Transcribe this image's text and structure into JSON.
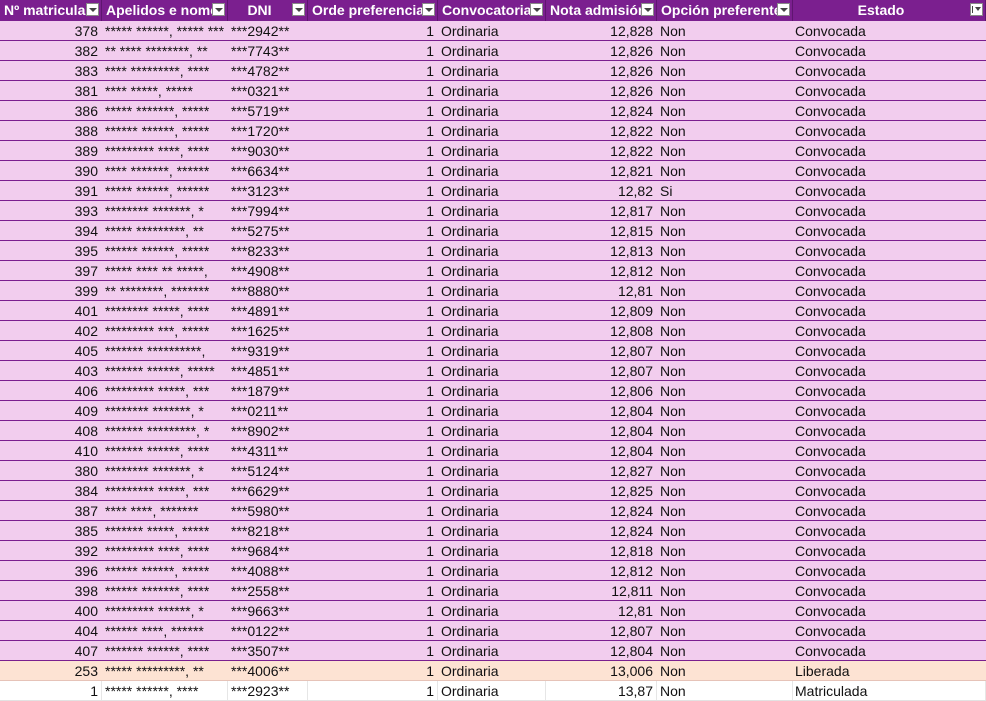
{
  "columns": [
    {
      "label": "Nº matricula"
    },
    {
      "label": "Apelidos e nome"
    },
    {
      "label": "DNI"
    },
    {
      "label": "Orde preferencia"
    },
    {
      "label": "Convocatoria"
    },
    {
      "label": "Nota admisión"
    },
    {
      "label": "Opción preferente"
    },
    {
      "label": "Estado"
    }
  ],
  "rows": [
    {
      "num": "378",
      "name": "***** ******, ***** ***",
      "dni": "***2942**",
      "orde": "1",
      "conv": "Ordinaria",
      "nota": "12,828",
      "opcion": "Non",
      "estado": "Convocada",
      "kind": "convocada"
    },
    {
      "num": "382",
      "name": "** **** ********, **",
      "dni": "***7743**",
      "orde": "1",
      "conv": "Ordinaria",
      "nota": "12,826",
      "opcion": "Non",
      "estado": "Convocada",
      "kind": "convocada"
    },
    {
      "num": "383",
      "name": "**** *********, ****",
      "dni": "***4782**",
      "orde": "1",
      "conv": "Ordinaria",
      "nota": "12,826",
      "opcion": "Non",
      "estado": "Convocada",
      "kind": "convocada"
    },
    {
      "num": "381",
      "name": "**** *****, *****",
      "dni": "***0321**",
      "orde": "1",
      "conv": "Ordinaria",
      "nota": "12,826",
      "opcion": "Non",
      "estado": "Convocada",
      "kind": "convocada"
    },
    {
      "num": "386",
      "name": "***** *******, *****",
      "dni": "***5719**",
      "orde": "1",
      "conv": "Ordinaria",
      "nota": "12,824",
      "opcion": "Non",
      "estado": "Convocada",
      "kind": "convocada"
    },
    {
      "num": "388",
      "name": "****** ******, *****",
      "dni": "***1720**",
      "orde": "1",
      "conv": "Ordinaria",
      "nota": "12,822",
      "opcion": "Non",
      "estado": "Convocada",
      "kind": "convocada"
    },
    {
      "num": "389",
      "name": "********* ****, ****",
      "dni": "***9030**",
      "orde": "1",
      "conv": "Ordinaria",
      "nota": "12,822",
      "opcion": "Non",
      "estado": "Convocada",
      "kind": "convocada"
    },
    {
      "num": "390",
      "name": "**** *******, ******",
      "dni": "***6634**",
      "orde": "1",
      "conv": "Ordinaria",
      "nota": "12,821",
      "opcion": "Non",
      "estado": "Convocada",
      "kind": "convocada"
    },
    {
      "num": "391",
      "name": "***** ******, ******",
      "dni": "***3123**",
      "orde": "1",
      "conv": "Ordinaria",
      "nota": "12,82",
      "opcion": "Si",
      "estado": "Convocada",
      "kind": "convocada"
    },
    {
      "num": "393",
      "name": "******** *******, *",
      "dni": "***7994**",
      "orde": "1",
      "conv": "Ordinaria",
      "nota": "12,817",
      "opcion": "Non",
      "estado": "Convocada",
      "kind": "convocada"
    },
    {
      "num": "394",
      "name": "***** *********, **",
      "dni": "***5275**",
      "orde": "1",
      "conv": "Ordinaria",
      "nota": "12,815",
      "opcion": "Non",
      "estado": "Convocada",
      "kind": "convocada"
    },
    {
      "num": "395",
      "name": "****** ******, *****",
      "dni": "***8233**",
      "orde": "1",
      "conv": "Ordinaria",
      "nota": "12,813",
      "opcion": "Non",
      "estado": "Convocada",
      "kind": "convocada"
    },
    {
      "num": "397",
      "name": "***** **** ** *****,",
      "dni": "***4908**",
      "orde": "1",
      "conv": "Ordinaria",
      "nota": "12,812",
      "opcion": "Non",
      "estado": "Convocada",
      "kind": "convocada"
    },
    {
      "num": "399",
      "name": "** ********, *******",
      "dni": "***8880**",
      "orde": "1",
      "conv": "Ordinaria",
      "nota": "12,81",
      "opcion": "Non",
      "estado": "Convocada",
      "kind": "convocada"
    },
    {
      "num": "401",
      "name": "******** *****, ****",
      "dni": "***4891**",
      "orde": "1",
      "conv": "Ordinaria",
      "nota": "12,809",
      "opcion": "Non",
      "estado": "Convocada",
      "kind": "convocada"
    },
    {
      "num": "402",
      "name": "********* ***, *****",
      "dni": "***1625**",
      "orde": "1",
      "conv": "Ordinaria",
      "nota": "12,808",
      "opcion": "Non",
      "estado": "Convocada",
      "kind": "convocada"
    },
    {
      "num": "405",
      "name": "******* **********,",
      "dni": "***9319**",
      "orde": "1",
      "conv": "Ordinaria",
      "nota": "12,807",
      "opcion": "Non",
      "estado": "Convocada",
      "kind": "convocada"
    },
    {
      "num": "403",
      "name": "******* ******, *****",
      "dni": "***4851**",
      "orde": "1",
      "conv": "Ordinaria",
      "nota": "12,807",
      "opcion": "Non",
      "estado": "Convocada",
      "kind": "convocada"
    },
    {
      "num": "406",
      "name": "********* *****, ***",
      "dni": "***1879**",
      "orde": "1",
      "conv": "Ordinaria",
      "nota": "12,806",
      "opcion": "Non",
      "estado": "Convocada",
      "kind": "convocada"
    },
    {
      "num": "409",
      "name": "******** *******, *",
      "dni": "***0211**",
      "orde": "1",
      "conv": "Ordinaria",
      "nota": "12,804",
      "opcion": "Non",
      "estado": "Convocada",
      "kind": "convocada"
    },
    {
      "num": "408",
      "name": "******* *********, *",
      "dni": "***8902**",
      "orde": "1",
      "conv": "Ordinaria",
      "nota": "12,804",
      "opcion": "Non",
      "estado": "Convocada",
      "kind": "convocada"
    },
    {
      "num": "410",
      "name": "******* ******, ****",
      "dni": "***4311**",
      "orde": "1",
      "conv": "Ordinaria",
      "nota": "12,804",
      "opcion": "Non",
      "estado": "Convocada",
      "kind": "convocada"
    },
    {
      "num": "380",
      "name": "******** *******, *",
      "dni": "***5124**",
      "orde": "1",
      "conv": "Ordinaria",
      "nota": "12,827",
      "opcion": "Non",
      "estado": "Convocada",
      "kind": "convocada"
    },
    {
      "num": "384",
      "name": "********* *****, ***",
      "dni": "***6629**",
      "orde": "1",
      "conv": "Ordinaria",
      "nota": "12,825",
      "opcion": "Non",
      "estado": "Convocada",
      "kind": "convocada"
    },
    {
      "num": "387",
      "name": "**** ****, *******",
      "dni": "***5980**",
      "orde": "1",
      "conv": "Ordinaria",
      "nota": "12,824",
      "opcion": "Non",
      "estado": "Convocada",
      "kind": "convocada"
    },
    {
      "num": "385",
      "name": "******* *****, *****",
      "dni": "***8218**",
      "orde": "1",
      "conv": "Ordinaria",
      "nota": "12,824",
      "opcion": "Non",
      "estado": "Convocada",
      "kind": "convocada"
    },
    {
      "num": "392",
      "name": "********* ****, ****",
      "dni": "***9684**",
      "orde": "1",
      "conv": "Ordinaria",
      "nota": "12,818",
      "opcion": "Non",
      "estado": "Convocada",
      "kind": "convocada"
    },
    {
      "num": "396",
      "name": "****** ******, *****",
      "dni": "***4088**",
      "orde": "1",
      "conv": "Ordinaria",
      "nota": "12,812",
      "opcion": "Non",
      "estado": "Convocada",
      "kind": "convocada"
    },
    {
      "num": "398",
      "name": "****** *******, ****",
      "dni": "***2558**",
      "orde": "1",
      "conv": "Ordinaria",
      "nota": "12,811",
      "opcion": "Non",
      "estado": "Convocada",
      "kind": "convocada"
    },
    {
      "num": "400",
      "name": "********* ******, *",
      "dni": "***9663**",
      "orde": "1",
      "conv": "Ordinaria",
      "nota": "12,81",
      "opcion": "Non",
      "estado": "Convocada",
      "kind": "convocada"
    },
    {
      "num": "404",
      "name": "****** ****, ******",
      "dni": "***0122**",
      "orde": "1",
      "conv": "Ordinaria",
      "nota": "12,807",
      "opcion": "Non",
      "estado": "Convocada",
      "kind": "convocada"
    },
    {
      "num": "407",
      "name": "******* ******, ****",
      "dni": "***3507**",
      "orde": "1",
      "conv": "Ordinaria",
      "nota": "12,804",
      "opcion": "Non",
      "estado": "Convocada",
      "kind": "convocada"
    },
    {
      "num": "253",
      "name": "***** *********, **",
      "dni": "***4006**",
      "orde": "1",
      "conv": "Ordinaria",
      "nota": "13,006",
      "opcion": "Non",
      "estado": "Liberada",
      "kind": "liberada"
    },
    {
      "num": "1",
      "name": "***** ******, ****",
      "dni": "***2923**",
      "orde": "1",
      "conv": "Ordinaria",
      "nota": "13,87",
      "opcion": "Non",
      "estado": "Matriculada",
      "kind": "matriculada"
    }
  ]
}
